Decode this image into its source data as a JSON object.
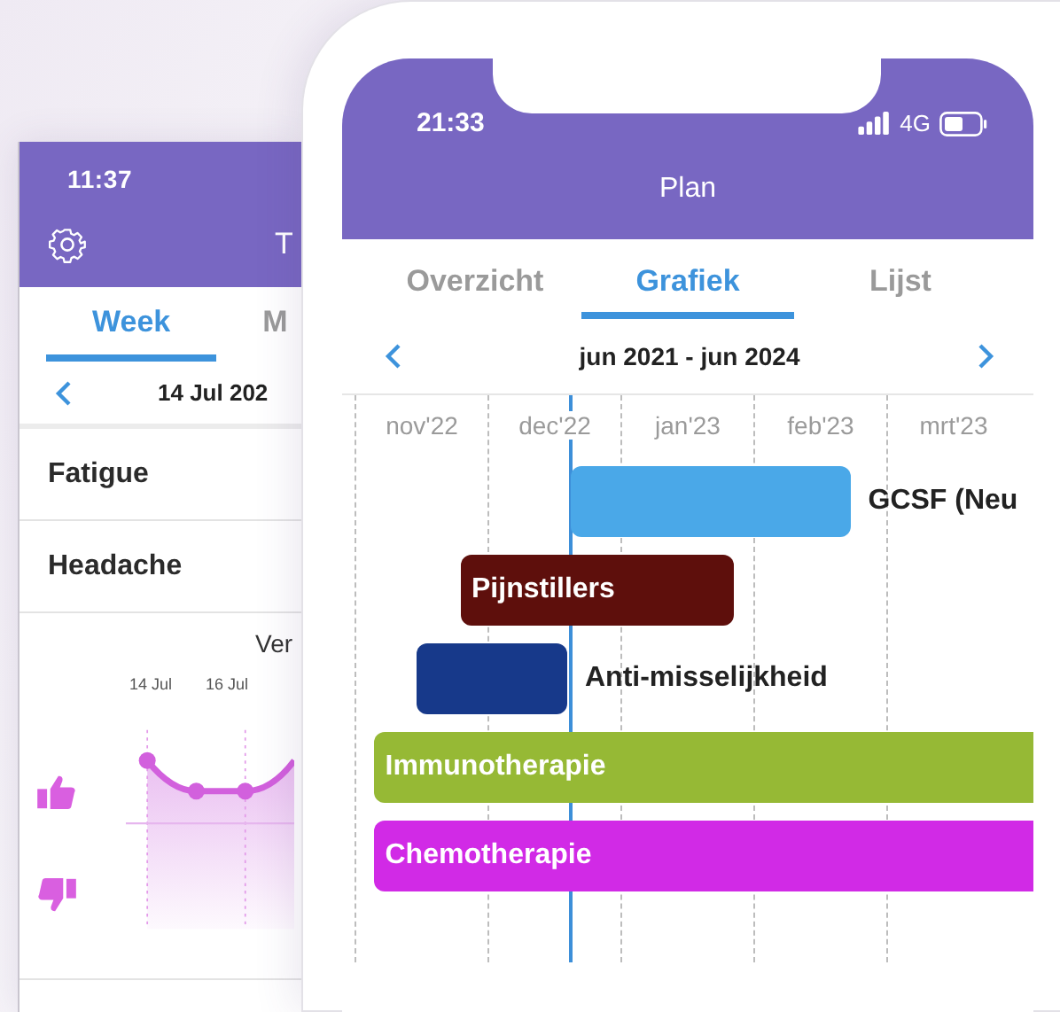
{
  "back_phone": {
    "status_time": "11:37",
    "title": "T",
    "tabs": [
      {
        "label": "Week",
        "selected": true
      },
      {
        "label": "M",
        "selected": false
      }
    ],
    "date": "14 Jul 202",
    "symptoms": [
      {
        "name": "Fatigue"
      },
      {
        "name": "Headache"
      }
    ],
    "chart": {
      "title": "Ver",
      "x_labels": [
        "14 Jul",
        "16 Jul"
      ]
    }
  },
  "front_phone": {
    "status_time": "21:33",
    "network": "4G",
    "title": "Plan",
    "tabs": [
      {
        "label": "Overzicht",
        "selected": false
      },
      {
        "label": "Grafiek",
        "selected": true
      },
      {
        "label": "Lijst",
        "selected": false
      }
    ],
    "range": "jun 2021 - jun 2024",
    "timeline": {
      "months": [
        {
          "label": "nov'22"
        },
        {
          "label": "dec'22"
        },
        {
          "label": "jan'23"
        },
        {
          "label": "feb'23"
        },
        {
          "label": "mrt'23"
        }
      ],
      "bars": [
        {
          "label": "GCSF (Neu",
          "color": "#4aa8e8",
          "kind": "outside"
        },
        {
          "label": "Pijnstillers",
          "color": "#5e0f0c",
          "kind": "inside"
        },
        {
          "label": "Anti-misselijkheid",
          "color": "#17398a",
          "kind": "outside"
        },
        {
          "label": "Immunotherapie",
          "color": "#96b935",
          "kind": "inside"
        },
        {
          "label": "Chemotherapie",
          "color": "#d12ae6",
          "kind": "inside"
        }
      ]
    }
  }
}
